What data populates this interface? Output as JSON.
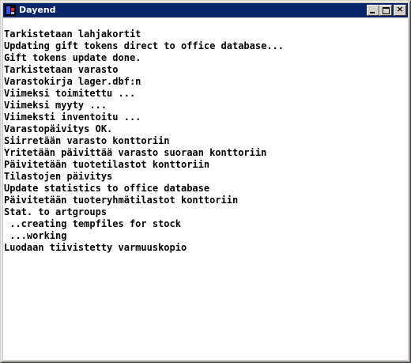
{
  "window": {
    "title": "Dayend",
    "icon": "dayend-app-icon",
    "controls": {
      "minimize": "minimize-icon",
      "maximize": "maximize-icon",
      "close_glyph": "×"
    }
  },
  "console": {
    "lines": [
      "Tarkistetaan lahjakortit",
      "Updating gift tokens direct to office database...",
      "Gift tokens update done.",
      "Tarkistetaan varasto",
      "Varastokirja lager.dbf:n",
      "Viimeksi toimitettu ...",
      "Viimeksi myyty ...",
      "Viimeksti inventoitu ...",
      "Varastopäivitys OK.",
      "Siirretään varasto konttoriin",
      "Yritetään päivittää varasto suoraan konttoriin",
      "Päivitetään tuotetilastot konttoriin",
      "Tilastojen päivitys",
      "Update statistics to office database",
      "Päivitetään tuoteryhmätilastot konttoriin",
      "Stat. to artgroups",
      " ..creating tempfiles for stock",
      " ...working",
      "Luodaan tiivistetty varmuuskopio"
    ]
  }
}
